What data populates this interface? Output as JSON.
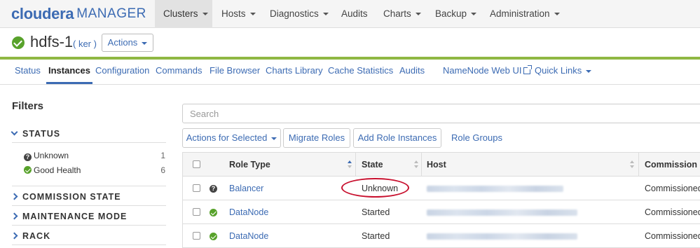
{
  "brand": {
    "name": "cloudera",
    "product": "MANAGER",
    "color": "#3c6bb3"
  },
  "topnav": {
    "items": [
      {
        "label": "Clusters",
        "dropdown": true,
        "active": true
      },
      {
        "label": "Hosts",
        "dropdown": true
      },
      {
        "label": "Diagnostics",
        "dropdown": true
      },
      {
        "label": "Audits",
        "dropdown": false
      },
      {
        "label": "Charts",
        "dropdown": true
      },
      {
        "label": "Backup",
        "dropdown": true
      },
      {
        "label": "Administration",
        "dropdown": true
      }
    ]
  },
  "service": {
    "name": "hdfs-1",
    "user": "( ker )",
    "status_icon": "check-circle-icon",
    "actions_label": "Actions",
    "accent_bar_color": "#8fb843"
  },
  "subnav": {
    "items": [
      {
        "label": "Status"
      },
      {
        "label": "Instances",
        "active": true
      },
      {
        "label": "Configuration"
      },
      {
        "label": "Commands"
      },
      {
        "label": "File Browser"
      },
      {
        "label": "Charts Library"
      },
      {
        "label": "Cache Statistics"
      },
      {
        "label": "Audits"
      },
      {
        "label": "NameNode Web UI",
        "icon": "external-link-icon"
      },
      {
        "label": "Quick Links",
        "dropdown": true
      }
    ]
  },
  "filters": {
    "title": "Filters",
    "status": {
      "label": "STATUS",
      "expanded": true,
      "items": [
        {
          "label": "Unknown",
          "count": "1",
          "icon": "question-circle-icon"
        },
        {
          "label": "Good Health",
          "count": "6",
          "icon": "check-circle-icon"
        }
      ]
    },
    "sections": [
      {
        "label": "COMMISSION STATE",
        "expanded": false
      },
      {
        "label": "MAINTENANCE MODE",
        "expanded": false
      },
      {
        "label": "RACK",
        "expanded": false
      }
    ]
  },
  "main": {
    "search_placeholder": "Search",
    "toolbar": {
      "actions_for_selected": "Actions for Selected",
      "migrate_roles": "Migrate Roles",
      "add_role_instances": "Add Role Instances",
      "role_groups": "Role Groups"
    },
    "table": {
      "columns": [
        "Role Type",
        "State",
        "Host",
        "Commission St"
      ],
      "sorted_column": "Role Type",
      "rows": [
        {
          "status_icon": "question-circle-icon",
          "role_type": "Balancer",
          "state": "Unknown",
          "host": "",
          "commission": "Commissioned",
          "highlighted": true
        },
        {
          "status_icon": "check-circle-icon",
          "role_type": "DataNode",
          "state": "Started",
          "host": "",
          "commission": "Commissioned"
        },
        {
          "status_icon": "check-circle-icon",
          "role_type": "DataNode",
          "state": "Started",
          "host": "",
          "commission": "Commissioned"
        }
      ]
    },
    "highlight_color": "#c8102e"
  }
}
